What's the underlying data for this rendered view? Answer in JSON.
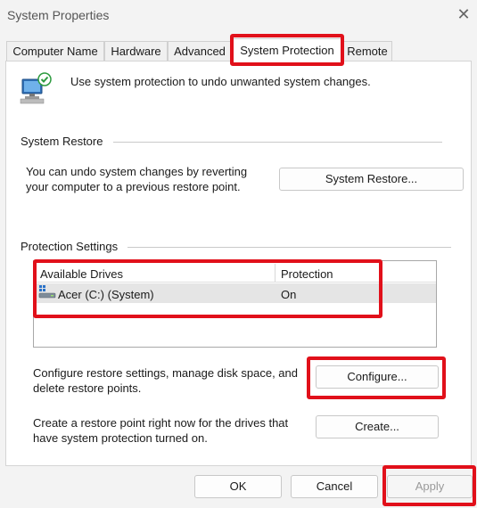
{
  "window": {
    "title": "System Properties",
    "close_glyph": "✕"
  },
  "tabs": [
    {
      "label": "Computer Name"
    },
    {
      "label": "Hardware"
    },
    {
      "label": "Advanced"
    },
    {
      "label": "System Protection",
      "active": true
    },
    {
      "label": "Remote"
    }
  ],
  "intro": {
    "text": "Use system protection to undo unwanted system changes.",
    "icon": "system-protection-icon"
  },
  "system_restore": {
    "title": "System Restore",
    "description_line1": "You can undo system changes by reverting",
    "description_line2": "your computer to a previous restore point.",
    "button_label": "System Restore..."
  },
  "protection_settings": {
    "title": "Protection Settings",
    "columns": [
      "Available Drives",
      "Protection"
    ],
    "drives": [
      {
        "name": "Acer (C:) (System)",
        "protection": "On",
        "icon": "drive-icon"
      }
    ],
    "configure_line1": "Configure restore settings, manage disk space, and",
    "configure_line2": "delete restore points.",
    "configure_label": "Configure...",
    "create_line1": "Create a restore point right now for the drives that",
    "create_line2": "have system protection turned on.",
    "create_label": "Create..."
  },
  "footer": {
    "ok_label": "OK",
    "cancel_label": "Cancel",
    "apply_label": "Apply"
  },
  "colors": {
    "highlight": "#e1101a",
    "selected_row": "#e5e5e5"
  }
}
